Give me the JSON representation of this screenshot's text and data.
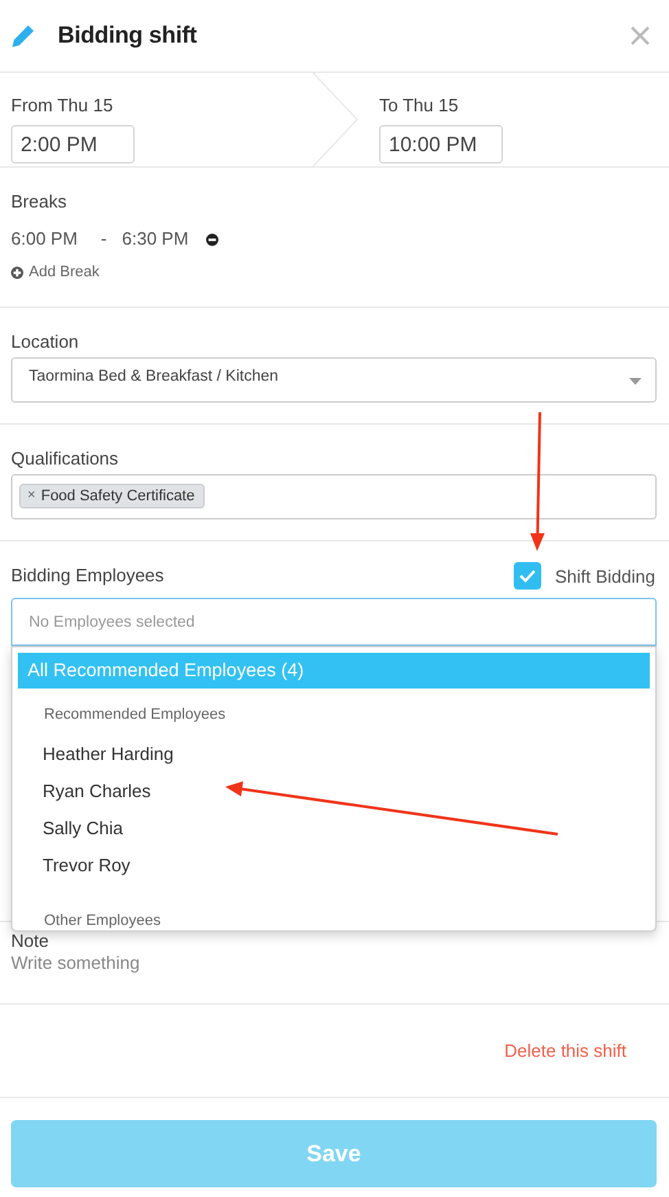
{
  "header": {
    "title": "Bidding shift"
  },
  "times": [
    {
      "label": "From Thu 15",
      "value": "2:00 PM"
    },
    {
      "label": "To Thu 15",
      "value": "10:00 PM"
    }
  ],
  "breaks": {
    "label": "Breaks",
    "items": [
      {
        "start": "6:00 PM",
        "separator": "-",
        "end": "6:30 PM"
      }
    ],
    "add": "Add Break"
  },
  "location": {
    "label": "Location",
    "value": "Taormina Bed & Breakfast / Kitchen"
  },
  "qualifications": {
    "label": "Qualifications",
    "tags": [
      {
        "remove": "×",
        "text": "Food Safety Certificate"
      }
    ]
  },
  "bidding": {
    "label": "Bidding Employees",
    "shift_bidding": {
      "label": "Shift Bidding",
      "checked": true
    },
    "field": {
      "placeholder": "No Employees selected"
    },
    "dropdown": {
      "options": [
        {
          "kind": "option",
          "label": "All Recommended Employees (4)",
          "selected": true
        },
        {
          "kind": "group",
          "label": "Recommended Employees"
        },
        {
          "kind": "option",
          "label": "Heather Harding",
          "selected": false
        },
        {
          "kind": "option",
          "label": "Ryan Charles",
          "selected": false
        },
        {
          "kind": "option",
          "label": "Sally Chia",
          "selected": false
        },
        {
          "kind": "option",
          "label": "Trevor Roy",
          "selected": false
        },
        {
          "kind": "group",
          "label": "Other Employees"
        }
      ]
    }
  },
  "note": {
    "label": "Note",
    "placeholder": "Write something"
  },
  "delete_link": "Delete this shift",
  "save_button": "Save"
}
